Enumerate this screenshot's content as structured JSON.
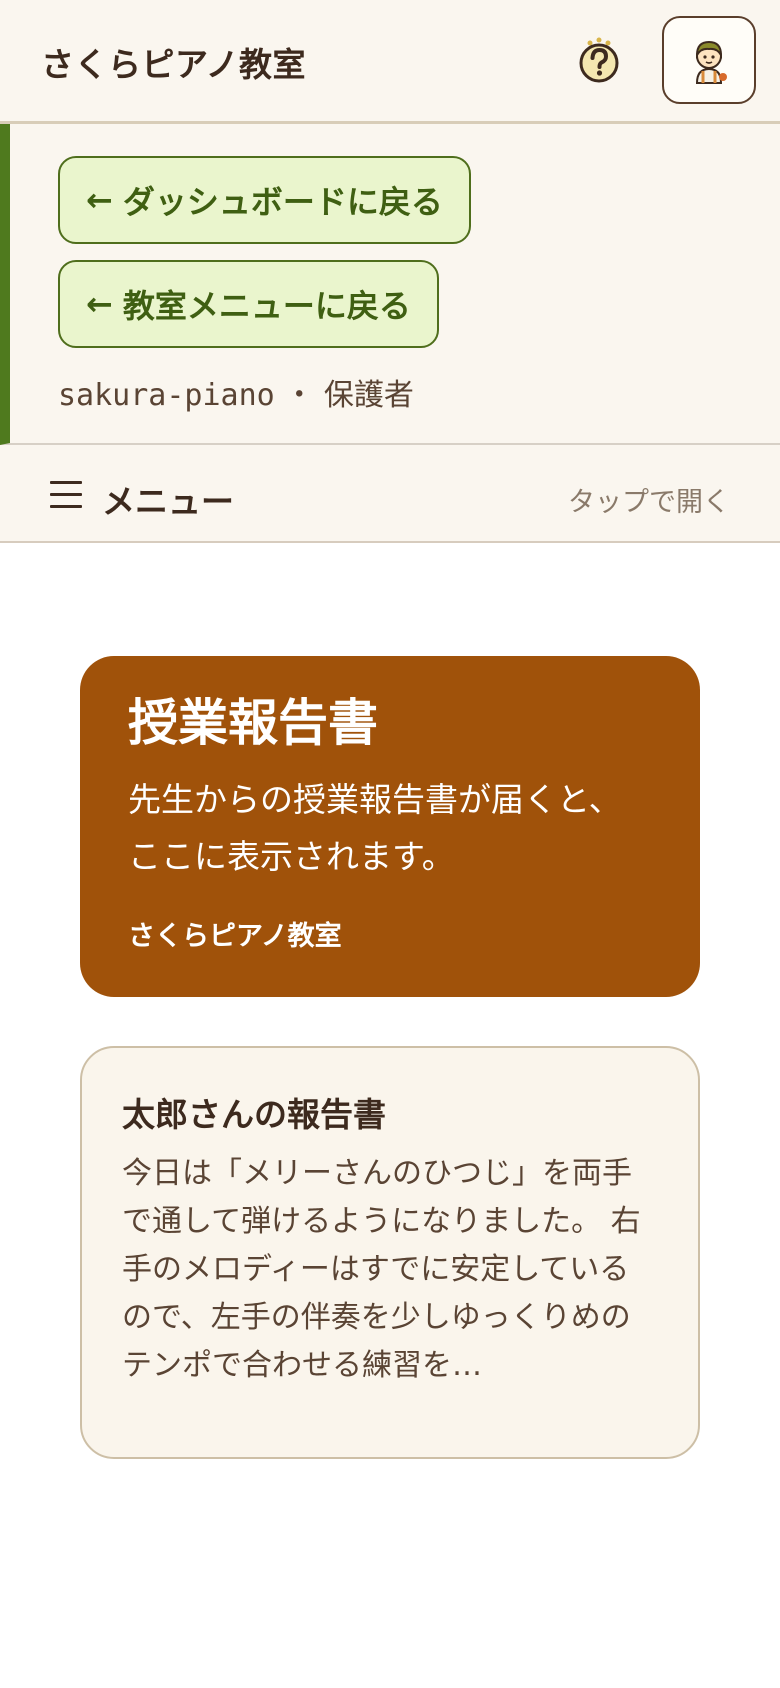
{
  "header": {
    "app_title": "さくらピアノ教室",
    "help_icon": "help-question-icon",
    "avatar_icon": "avatar-icon"
  },
  "context": {
    "back_dashboard_label": "ダッシュボードに戻る",
    "back_menu_label": "教室メニューに戻る",
    "arrow": "←",
    "school_id": "sakura-piano",
    "separator": " ・ ",
    "role": "保護者"
  },
  "menu": {
    "label": "メニュー",
    "hint": "タップで開く",
    "icon": "hamburger-icon"
  },
  "hero": {
    "title": "授業報告書",
    "description": "先生からの授業報告書が届くと、ここに表示されます。",
    "school": "さくらピアノ教室"
  },
  "report": {
    "title": "太郎さんの報告書",
    "body": "今日は「メリーさんのひつじ」を両手で通して弾けるようになりました。 右手のメロディーはすでに安定しているので、左手の伴奏を少しゆっくりめのテンポで合わせる練習を…"
  },
  "colors": {
    "accent_green": "#4f7a1e",
    "hero_brown": "#a0520a",
    "button_bg": "#eaf5cd"
  }
}
